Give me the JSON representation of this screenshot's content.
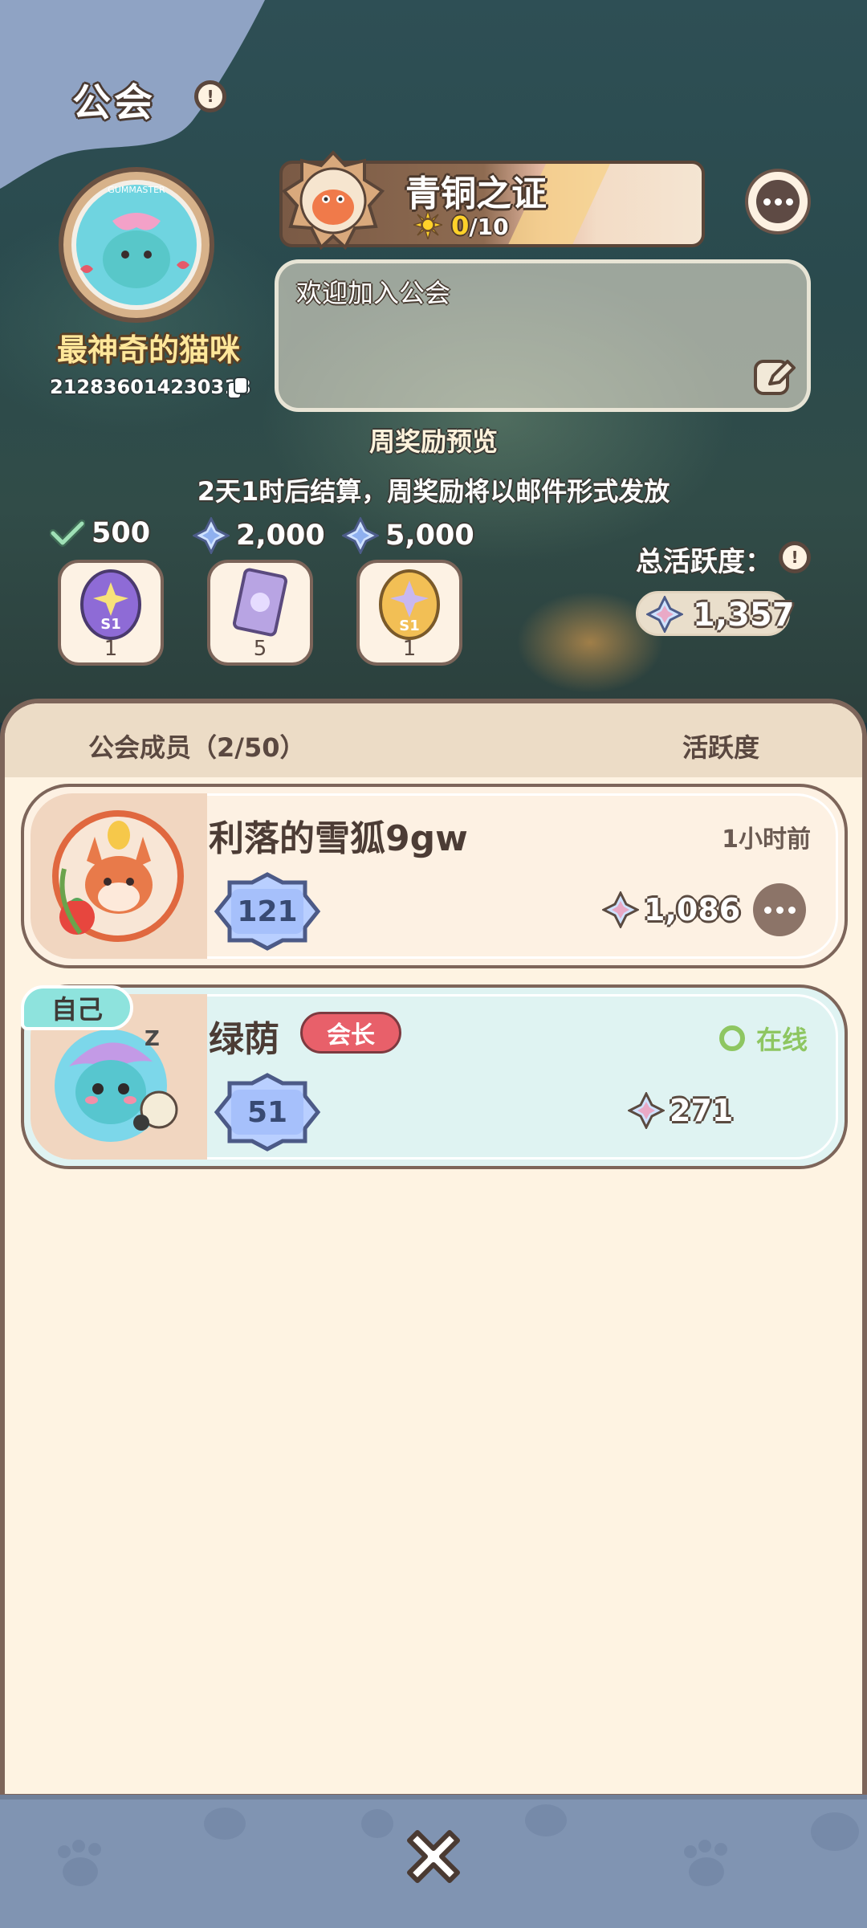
{
  "header": {
    "title": "公会",
    "info_icon": "info-icon"
  },
  "guild": {
    "name": "最神奇的猫咪",
    "id": "212836014230318",
    "badge_text": "GUMMASTER"
  },
  "rank": {
    "title": "青铜之证",
    "progress_current": "0",
    "progress_total": "/10"
  },
  "announcement": {
    "text": "欢迎加入公会"
  },
  "weekly": {
    "title": "周奖励预览",
    "description": "2天1时后结算，周奖励将以邮件形式发放",
    "tiers": [
      {
        "threshold": "500",
        "icon": "check-icon",
        "reward_count": "1",
        "reward_icon": "purple-egg-icon"
      },
      {
        "threshold": "2,000",
        "icon": "star-diamond-icon",
        "reward_count": "5",
        "reward_icon": "card-icon"
      },
      {
        "threshold": "5,000",
        "icon": "star-diamond-icon",
        "reward_count": "1",
        "reward_icon": "gold-egg-icon"
      }
    ]
  },
  "total_activity": {
    "label": "总活跃度：",
    "value": "1,357"
  },
  "members_panel": {
    "header_left": "公会成员（2/50）",
    "header_right": "活跃度",
    "members": [
      {
        "name": "利落的雪狐9gw",
        "level": "121",
        "activity": "1,086",
        "last_seen": "1小时前"
      },
      {
        "name": "绿荫",
        "level": "51",
        "activity": "271",
        "role": "会长",
        "status": "在线",
        "self_tag": "自己"
      }
    ]
  },
  "colors": {
    "panel_bg": "#fef3e2",
    "border": "#7d655a",
    "online": "#8ec661",
    "leader": "#e8606a",
    "bottom_bar": "#8094b2"
  }
}
